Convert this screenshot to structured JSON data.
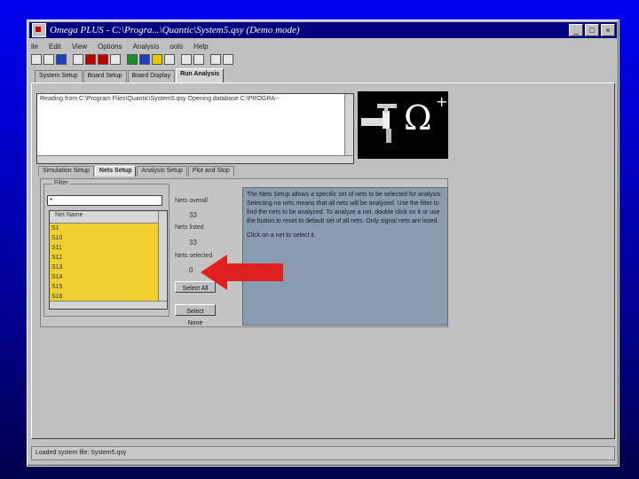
{
  "window": {
    "title": "Omega PLUS - C:\\Progra...\\Quantic\\System5.qsy (Demo mode)"
  },
  "menu": [
    "ile",
    "Edit",
    "View",
    "Options",
    "Analysis",
    "ools",
    "Help"
  ],
  "main_tabs": [
    "System Setup",
    "Board Setup",
    "Board Display",
    "Run Analysis"
  ],
  "log": {
    "text": "Reading from C:\\Program Files\\Quantic\\System5.qsy Opening database C:\\PROGRA~"
  },
  "logo": {
    "symbol": "Ω",
    "plus": "+"
  },
  "sub_tabs": [
    "Simulation Setup",
    "Nets Setup",
    "Analysis Setup",
    "Plot and Stop"
  ],
  "filter": {
    "label": "Filter",
    "value": "*"
  },
  "netlist": {
    "header": "Net Name",
    "items": [
      "S1",
      "S10",
      "S11",
      "S12",
      "S13",
      "S14",
      "S15",
      "S16"
    ]
  },
  "stats": {
    "nets_overall_label": "Nets overall",
    "nets_overall_value": "33",
    "nets_listed_label": "Nets listed",
    "nets_listed_value": "33",
    "nets_selected_label": "Nets selected",
    "nets_selected_value": "0"
  },
  "buttons": {
    "select_all": "Select All",
    "deselect_none": "Select None"
  },
  "help": {
    "text1": "The Nets Setup allows a specific set of nets to be selected for analysis. Selecting no nets means that all nets will be analyzed. Use the filter to find the nets to be analyzed. To analyze a net, double click on it or use the button to reset to default set of all nets. Only signal nets are listed.",
    "text2": "Click on a net to select it."
  },
  "status": {
    "text": "Loaded system file: System5.qsy"
  },
  "colors": {
    "arrow": "#e02020",
    "list_bg": "#f0d030",
    "title_bg": "#000080"
  }
}
